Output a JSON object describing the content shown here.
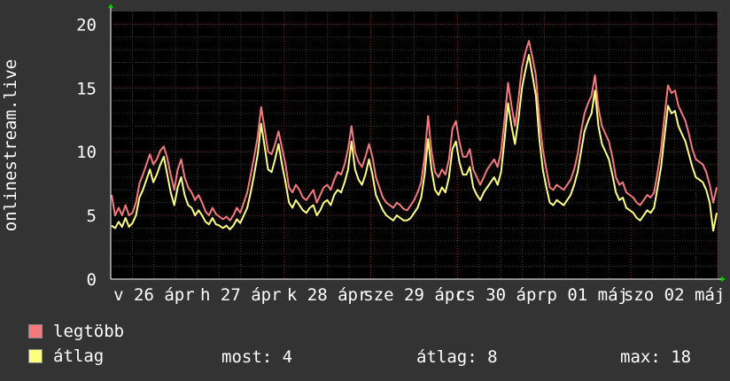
{
  "chart_data": {
    "type": "line",
    "ylabel": "onlinestream.live",
    "ylim": [
      0,
      21
    ],
    "yticks": [
      0,
      5,
      10,
      15,
      20
    ],
    "x_tick_labels": [
      "v 26 ápr",
      "h 27 ápr",
      "k 28 ápr",
      "sze 29 ápr",
      "cs 30 ápr",
      "p 01 máj",
      "szo 02 máj"
    ],
    "grid": true,
    "series": [
      {
        "name": "legtöbb",
        "color": "#f47a7f",
        "values": [
          6.6,
          5.0,
          5.6,
          5.0,
          5.8,
          5.0,
          5.2,
          6.0,
          7.5,
          8.2,
          9.0,
          9.8,
          9.0,
          9.4,
          10.1,
          10.4,
          9.5,
          8.2,
          7.0,
          8.6,
          9.4,
          8.0,
          7.2,
          6.8,
          6.2,
          6.6,
          6.0,
          5.3,
          5.0,
          5.6,
          5.1,
          4.9,
          4.7,
          4.9,
          4.6,
          5.0,
          5.6,
          5.2,
          6.0,
          6.8,
          8.2,
          9.6,
          11.2,
          13.5,
          11.8,
          10.0,
          9.8,
          10.6,
          11.6,
          10.3,
          9.0,
          7.2,
          6.8,
          7.4,
          7.0,
          6.4,
          6.2,
          6.6,
          7.0,
          6.0,
          6.6,
          7.2,
          7.4,
          7.0,
          7.8,
          8.4,
          8.2,
          9.0,
          10.2,
          12.0,
          10.0,
          9.2,
          8.8,
          9.6,
          10.6,
          9.6,
          8.0,
          7.2,
          6.4,
          6.0,
          5.8,
          5.6,
          6.0,
          5.8,
          5.5,
          5.4,
          5.8,
          6.2,
          6.8,
          7.6,
          9.6,
          12.8,
          10.0,
          8.4,
          8.0,
          8.6,
          8.2,
          9.4,
          11.8,
          12.4,
          10.8,
          9.6,
          9.6,
          10.2,
          8.6,
          8.0,
          7.4,
          8.0,
          8.6,
          9.0,
          9.4,
          8.8,
          10.0,
          12.6,
          15.4,
          13.6,
          12.0,
          14.2,
          16.6,
          17.8,
          18.7,
          17.4,
          16.0,
          12.6,
          10.2,
          8.6,
          7.2,
          7.0,
          7.4,
          7.2,
          7.0,
          7.4,
          7.8,
          8.6,
          9.8,
          11.6,
          13.0,
          13.8,
          14.4,
          16.0,
          13.4,
          12.0,
          11.4,
          10.8,
          9.6,
          8.0,
          7.4,
          7.6,
          6.8,
          6.6,
          6.4,
          6.0,
          5.8,
          6.2,
          6.6,
          6.4,
          6.8,
          8.4,
          10.2,
          12.8,
          15.2,
          14.6,
          14.8,
          13.6,
          13.0,
          12.4,
          11.4,
          10.2,
          9.4,
          9.2,
          9.0,
          8.4,
          7.4,
          6.0,
          7.2
        ]
      },
      {
        "name": "átlag",
        "color": "#ffff80",
        "values": [
          4.2,
          4.0,
          4.5,
          4.1,
          4.8,
          4.1,
          4.4,
          5.0,
          6.4,
          7.0,
          7.8,
          8.6,
          7.6,
          8.2,
          9.0,
          9.6,
          8.2,
          6.8,
          5.8,
          7.2,
          8.0,
          6.6,
          5.8,
          5.6,
          5.0,
          5.4,
          5.0,
          4.5,
          4.3,
          4.8,
          4.3,
          4.2,
          4.0,
          4.2,
          3.9,
          4.2,
          4.7,
          4.4,
          5.0,
          5.6,
          6.8,
          8.2,
          9.8,
          12.2,
          10.4,
          8.6,
          8.4,
          9.4,
          10.6,
          9.0,
          7.6,
          6.0,
          5.6,
          6.2,
          5.8,
          5.4,
          5.2,
          5.6,
          5.8,
          5.0,
          5.4,
          6.0,
          6.2,
          5.8,
          6.6,
          7.0,
          6.8,
          7.6,
          8.6,
          10.8,
          8.6,
          7.8,
          7.4,
          8.2,
          9.4,
          8.2,
          6.6,
          6.0,
          5.4,
          5.0,
          4.8,
          4.6,
          5.0,
          4.8,
          4.6,
          4.6,
          4.8,
          5.2,
          5.6,
          6.4,
          8.2,
          11.0,
          8.6,
          7.0,
          6.6,
          7.2,
          6.8,
          8.0,
          10.2,
          10.8,
          9.2,
          8.2,
          8.2,
          8.8,
          7.2,
          6.6,
          6.2,
          6.8,
          7.2,
          7.6,
          8.0,
          7.4,
          8.4,
          11.0,
          13.8,
          12.0,
          10.6,
          12.6,
          15.0,
          16.4,
          17.6,
          16.0,
          14.4,
          11.0,
          8.6,
          7.2,
          6.0,
          5.8,
          6.2,
          6.0,
          5.8,
          6.2,
          6.6,
          7.4,
          8.4,
          10.0,
          11.6,
          12.4,
          13.0,
          14.8,
          12.0,
          10.6,
          10.0,
          9.4,
          8.2,
          6.8,
          6.2,
          6.4,
          5.6,
          5.4,
          5.2,
          4.8,
          4.6,
          5.0,
          5.4,
          5.2,
          5.6,
          7.2,
          8.8,
          11.2,
          13.6,
          13.0,
          13.2,
          12.0,
          11.4,
          10.8,
          9.8,
          8.8,
          8.0,
          7.8,
          7.6,
          7.0,
          6.0,
          3.8,
          5.2
        ]
      }
    ]
  },
  "legend": {
    "items": [
      {
        "label": "legtöbb",
        "color": "#f47a7f"
      },
      {
        "label": "átlag",
        "color": "#ffff80"
      }
    ]
  },
  "stats": {
    "most": "most: 4",
    "atlag": "átlag: 8",
    "max": "max: 18"
  }
}
